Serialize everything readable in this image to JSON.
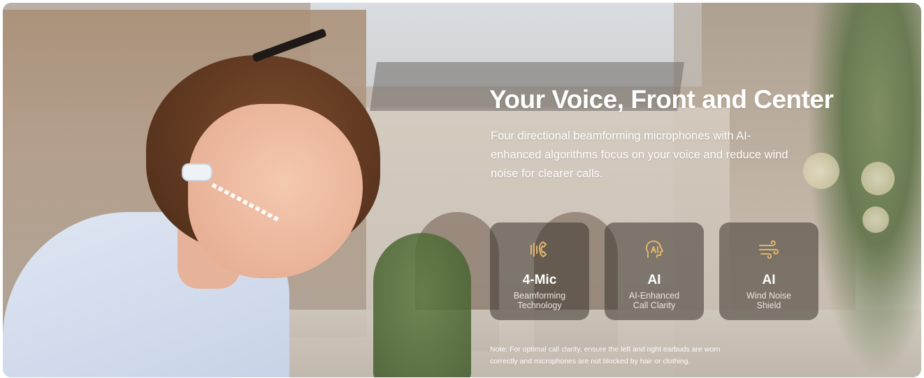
{
  "hero": {
    "headline": "Your Voice, Front and Center",
    "description": "Four directional beamforming microphones with AI-enhanced algorithms focus on your voice and reduce wind noise for clearer calls.",
    "features": [
      {
        "icon": "microphone-beam-icon",
        "title": "4-Mic",
        "subtitle": "Beamforming\nTechnology"
      },
      {
        "icon": "ai-head-icon",
        "title": "AI",
        "subtitle": "AI-Enhanced\nCall Clarity"
      },
      {
        "icon": "wind-icon",
        "title": "AI",
        "subtitle": "Wind Noise\nShield"
      }
    ],
    "note": "Note: For optimal call clarity, ensure the left and right earbuds are worn correctly and microphones are not blocked by hair or clothing."
  },
  "colors": {
    "accent_gold": "#e2b56a",
    "card_bg": "rgba(60,52,46,.55)",
    "text": "#ffffff"
  }
}
